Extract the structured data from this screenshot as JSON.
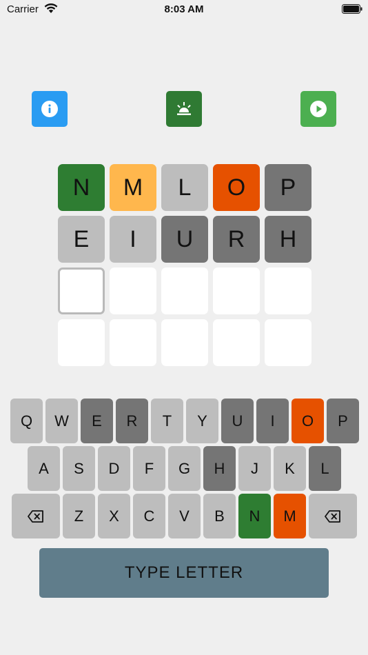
{
  "status_bar": {
    "carrier": "Carrier",
    "time": "8:03 AM"
  },
  "colors": {
    "green": "#2e7d32",
    "yellow": "#ffb74d",
    "orange": "#e65100",
    "light_gray": "#bdbdbd",
    "dark_gray": "#757575",
    "empty": "#ffffff",
    "info_button": "#2a9cf2",
    "alarm_button": "#2f7a33",
    "play_button": "#4caf50",
    "type_button": "#607d8b"
  },
  "toolbar": {
    "info_icon": "info-icon",
    "alarm_icon": "alarm-light-icon",
    "play_icon": "play-icon"
  },
  "board": {
    "rows": [
      [
        {
          "letter": "N",
          "state": "green"
        },
        {
          "letter": "M",
          "state": "yellow"
        },
        {
          "letter": "L",
          "state": "light_gray"
        },
        {
          "letter": "O",
          "state": "orange"
        },
        {
          "letter": "P",
          "state": "dark_gray"
        }
      ],
      [
        {
          "letter": "E",
          "state": "light_gray"
        },
        {
          "letter": "I",
          "state": "light_gray"
        },
        {
          "letter": "U",
          "state": "dark_gray"
        },
        {
          "letter": "R",
          "state": "dark_gray"
        },
        {
          "letter": "H",
          "state": "dark_gray"
        }
      ],
      [
        {
          "letter": "",
          "state": "active"
        },
        {
          "letter": "",
          "state": "empty"
        },
        {
          "letter": "",
          "state": "empty"
        },
        {
          "letter": "",
          "state": "empty"
        },
        {
          "letter": "",
          "state": "empty"
        }
      ],
      [
        {
          "letter": "",
          "state": "empty"
        },
        {
          "letter": "",
          "state": "empty"
        },
        {
          "letter": "",
          "state": "empty"
        },
        {
          "letter": "",
          "state": "empty"
        },
        {
          "letter": "",
          "state": "empty"
        }
      ]
    ]
  },
  "keyboard": {
    "rows": [
      [
        {
          "label": "Q",
          "state": "light_gray"
        },
        {
          "label": "W",
          "state": "light_gray"
        },
        {
          "label": "E",
          "state": "dark_gray"
        },
        {
          "label": "R",
          "state": "dark_gray"
        },
        {
          "label": "T",
          "state": "light_gray"
        },
        {
          "label": "Y",
          "state": "light_gray"
        },
        {
          "label": "U",
          "state": "dark_gray"
        },
        {
          "label": "I",
          "state": "dark_gray"
        },
        {
          "label": "O",
          "state": "orange"
        },
        {
          "label": "P",
          "state": "dark_gray"
        }
      ],
      [
        {
          "label": "A",
          "state": "light_gray"
        },
        {
          "label": "S",
          "state": "light_gray"
        },
        {
          "label": "D",
          "state": "light_gray"
        },
        {
          "label": "F",
          "state": "light_gray"
        },
        {
          "label": "G",
          "state": "light_gray"
        },
        {
          "label": "H",
          "state": "dark_gray"
        },
        {
          "label": "J",
          "state": "light_gray"
        },
        {
          "label": "K",
          "state": "light_gray"
        },
        {
          "label": "L",
          "state": "dark_gray"
        }
      ],
      [
        {
          "label": "",
          "icon": "backspace-icon",
          "state": "light_gray",
          "wide": true
        },
        {
          "label": "Z",
          "state": "light_gray"
        },
        {
          "label": "X",
          "state": "light_gray"
        },
        {
          "label": "C",
          "state": "light_gray"
        },
        {
          "label": "V",
          "state": "light_gray"
        },
        {
          "label": "B",
          "state": "light_gray"
        },
        {
          "label": "N",
          "state": "green"
        },
        {
          "label": "M",
          "state": "orange"
        },
        {
          "label": "",
          "icon": "backspace-icon",
          "state": "light_gray",
          "wide": true
        }
      ]
    ]
  },
  "action": {
    "type_letter_label": "TYPE LETTER"
  }
}
